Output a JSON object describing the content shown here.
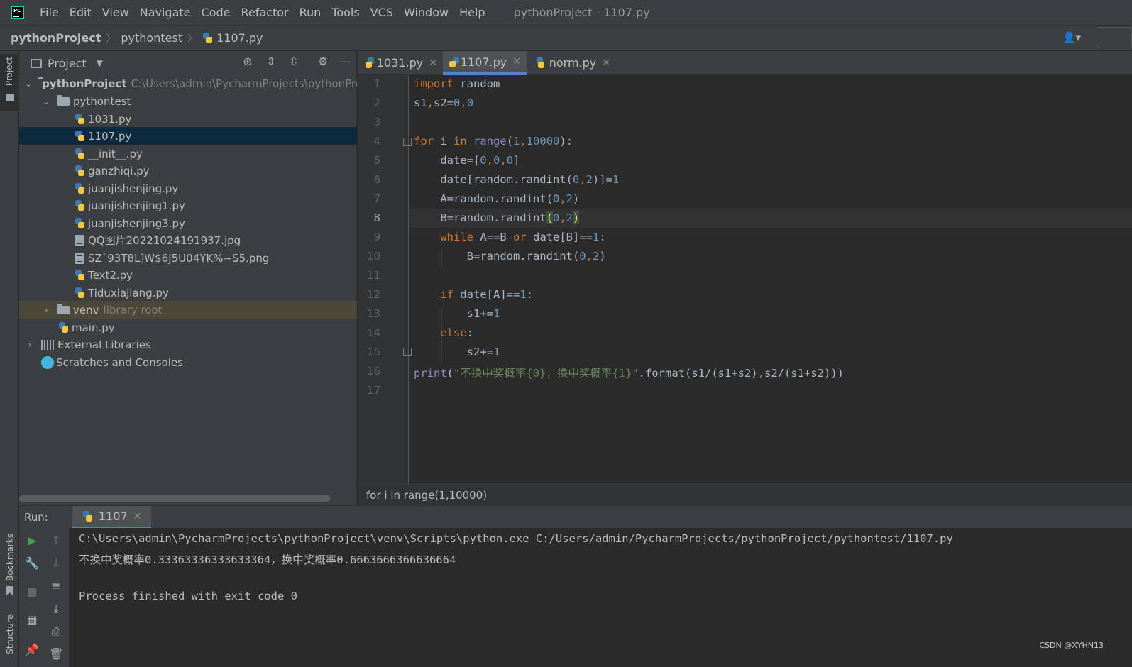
{
  "menubar": {
    "items": [
      "File",
      "Edit",
      "View",
      "Navigate",
      "Code",
      "Refactor",
      "Run",
      "Tools",
      "VCS",
      "Window",
      "Help"
    ],
    "window_title": "pythonProject - 1107.py"
  },
  "breadcrumb": {
    "project": "pythonProject",
    "folder": "pythontest",
    "file": "1107.py"
  },
  "left_strip": {
    "project_label": "Project",
    "bookmarks_label": "Bookmarks",
    "structure_label": "Structure"
  },
  "project_panel": {
    "title": "Project",
    "root_name": "pythonProject",
    "root_path": "C:\\Users\\admin\\PycharmProjects\\pythonPro",
    "folder": "pythontest",
    "files": [
      "1031.py",
      "1107.py",
      "__init__.py",
      "ganzhiqi.py",
      "juanjishenjing.py",
      "juanjishenjing1.py",
      "juanjishenjing3.py",
      "QQ图片20221024191937.jpg",
      "SZ`93T8L]W$6J5U04YK%~S5.png",
      "Text2.py",
      "Tiduxiajiang.py"
    ],
    "venv": "venv",
    "venv_note": "library root",
    "main_file": "main.py",
    "external_libraries": "External Libraries",
    "scratches": "Scratches and Consoles"
  },
  "editor_tabs": [
    {
      "label": "1031.py",
      "active": false
    },
    {
      "label": "1107.py",
      "active": true
    },
    {
      "label": "norm.py",
      "active": false
    }
  ],
  "line_numbers": [
    "1",
    "2",
    "3",
    "4",
    "5",
    "6",
    "7",
    "8",
    "9",
    "10",
    "11",
    "12",
    "13",
    "14",
    "15",
    "16",
    "17"
  ],
  "code": {
    "l1_kw": "import",
    "l1_rest": " random",
    "l2_a": "s1",
    "l2_b": ",",
    "l2_c": "s2=",
    "l2_n1": "0",
    "l2_d": ",",
    "l2_n2": "0",
    "l4_for": "for",
    "l4_a": " i ",
    "l4_in": "in",
    "l4_sp": " ",
    "l4_range": "range",
    "l4_p": "(",
    "l4_n1": "1",
    "l4_c": ",",
    "l4_n2": "10000",
    "l4_e": "):",
    "l5_a": "    date=[",
    "l5_n1": "0",
    "l5_c1": ",",
    "l5_n2": "0",
    "l5_c2": ",",
    "l5_n3": "0",
    "l5_e": "]",
    "l6_a": "    date[random.randint(",
    "l6_n1": "0",
    "l6_c": ",",
    "l6_n2": "2",
    "l6_b": ")]=",
    "l6_n3": "1",
    "l7_a": "    A=random.randint(",
    "l7_n1": "0",
    "l7_c": ",",
    "l7_n2": "2",
    "l7_e": ")",
    "l8_a": "    B=random.randint",
    "l8_p": "(",
    "l8_n1": "0",
    "l8_c": ",",
    "l8_n2": "2",
    "l8_e": ")",
    "l9_ind": "    ",
    "l9_while": "while",
    "l9_a": " A==B ",
    "l9_or": "or",
    "l9_b": " date[B]==",
    "l9_n": "1",
    "l9_e": ":",
    "l10_a": "        B=random.randint(",
    "l10_n1": "0",
    "l10_c": ",",
    "l10_n2": "2",
    "l10_e": ")",
    "l12_ind": "    ",
    "l12_if": "if",
    "l12_a": " date[A]==",
    "l12_n": "1",
    "l12_e": ":",
    "l13_a": "        s1+=",
    "l13_n": "1",
    "l14_ind": "    ",
    "l14_else": "else",
    "l14_e": ":",
    "l15_a": "        s2+=",
    "l15_n": "1",
    "l16_print": "print",
    "l16_p": "(",
    "l16_str": "\"不换中奖概率{0}，换中奖概率{1}\"",
    "l16_a": ".format(s1/(s1+s2)",
    "l16_c": ",",
    "l16_b": "s2/(s1+s2)))"
  },
  "editor_status": "for i in range(1,10000)",
  "run_panel": {
    "label": "Run:",
    "tab": "1107",
    "output": [
      "C:\\Users\\admin\\PycharmProjects\\pythonProject\\venv\\Scripts\\python.exe C:/Users/admin/PycharmProjects/pythonProject/pythontest/1107.py",
      "不换中奖概率0.33363336333633364，换中奖概率0.6663666366636664",
      "",
      "Process finished with exit code 0"
    ]
  },
  "watermark": "CSDN @XYHN13",
  "colors": {
    "keyword": "#cc7832",
    "number": "#6897bb",
    "string": "#6a8759",
    "builtin": "#8888c6",
    "selection": "#0d293e",
    "accent": "#4a88c7"
  }
}
